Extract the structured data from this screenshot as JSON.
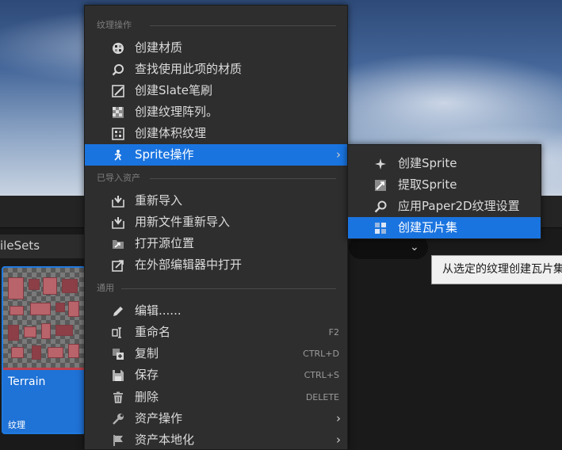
{
  "background": {
    "tab_label": "ileSets",
    "asset": {
      "name": "Terrain",
      "type": "纹理"
    }
  },
  "menu": {
    "sections": [
      {
        "title": "纹理操作"
      },
      {
        "title": "已导入资产"
      },
      {
        "title": "通用"
      }
    ],
    "texture_actions": [
      {
        "label": "创建材质",
        "icon": "create-material-icon"
      },
      {
        "label": "查找使用此项的材质",
        "icon": "find-icon"
      },
      {
        "label": "创建Slate笔刷",
        "icon": "slate-brush-icon"
      },
      {
        "label": "创建纹理阵列。",
        "icon": "texture-array-icon"
      },
      {
        "label": "创建体积纹理",
        "icon": "volume-texture-icon"
      },
      {
        "label": "Sprite操作",
        "icon": "sprite-icon",
        "has_submenu": true,
        "highlighted": true
      }
    ],
    "imported_asset": [
      {
        "label": "重新导入",
        "icon": "reimport-icon"
      },
      {
        "label": "用新文件重新导入",
        "icon": "reimport-new-file-icon"
      },
      {
        "label": "打开源位置",
        "icon": "open-folder-icon"
      },
      {
        "label": "在外部编辑器中打开",
        "icon": "external-editor-icon"
      }
    ],
    "common": [
      {
        "label": "编辑......",
        "icon": "edit-icon"
      },
      {
        "label": "重命名",
        "icon": "rename-icon",
        "shortcut": "F2"
      },
      {
        "label": "复制",
        "icon": "duplicate-icon",
        "shortcut": "CTRL+D"
      },
      {
        "label": "保存",
        "icon": "save-icon",
        "shortcut": "CTRL+S"
      },
      {
        "label": "删除",
        "icon": "delete-icon",
        "shortcut": "DELETE"
      },
      {
        "label": "资产操作",
        "icon": "wrench-icon",
        "has_submenu": true
      },
      {
        "label": "资产本地化",
        "icon": "flag-icon",
        "has_submenu": true
      }
    ]
  },
  "submenu": {
    "items": [
      {
        "label": "创建Sprite",
        "icon": "create-sprite-icon"
      },
      {
        "label": "提取Sprite",
        "icon": "extract-sprite-icon"
      },
      {
        "label": "应用Paper2D纹理设置",
        "icon": "paper2d-settings-icon"
      },
      {
        "label": "创建瓦片集",
        "icon": "tileset-icon",
        "highlighted": true
      }
    ]
  },
  "tooltip": {
    "text": "从选定的纹理创建瓦片集"
  },
  "colors": {
    "highlight": "#1a74e0",
    "menu_bg": "#2e2e2e",
    "section_text": "#7e7e7e"
  }
}
